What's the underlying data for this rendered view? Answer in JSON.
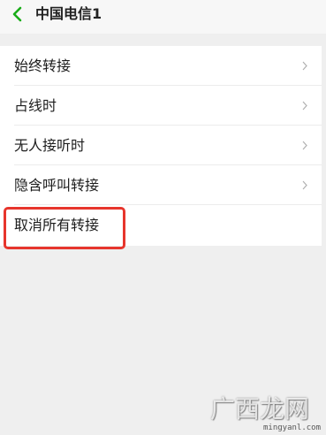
{
  "header": {
    "back_icon": "chevron-left-icon",
    "title": "中国电信1",
    "accent_color": "#1aad19"
  },
  "menu": {
    "items": [
      {
        "label": "始终转接",
        "icon": "chevron-right-icon"
      },
      {
        "label": "占线时",
        "icon": "chevron-right-icon"
      },
      {
        "label": "无人接听时",
        "icon": "chevron-right-icon"
      },
      {
        "label": "隐含呼叫转接",
        "icon": "chevron-right-icon"
      },
      {
        "label": "取消所有转接"
      }
    ]
  },
  "annotation": {
    "highlight_color": "#e7352c"
  },
  "watermark": {
    "text": "广西龙网",
    "url": "mingyanl.com"
  }
}
